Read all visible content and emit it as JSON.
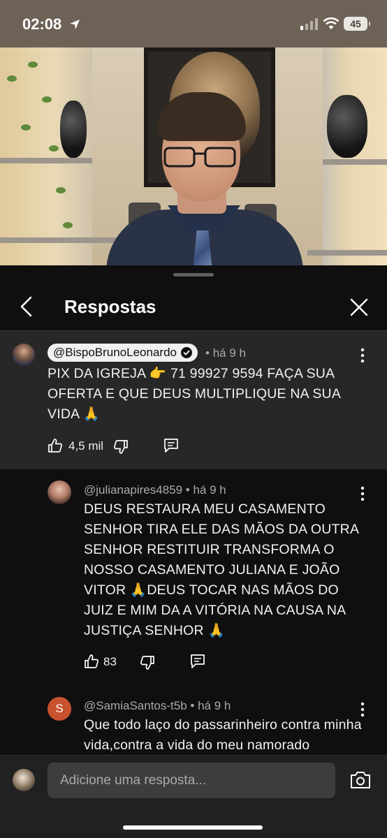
{
  "status_bar": {
    "time": "02:08",
    "battery": "45"
  },
  "header": {
    "title": "Respostas"
  },
  "pinned_comment": {
    "author": "@BispoBrunoLeonardo",
    "time": "há 9 h",
    "text": "PIX DA IGREJA 👉 71 99927 9594  FAÇA SUA OFERTA E QUE DEUS MULTIPLIQUE NA SUA VIDA 🙏",
    "likes": "4,5 mil"
  },
  "replies": [
    {
      "author": "@julianapires4859",
      "time": "há 9 h",
      "text": "DEUS RESTAURA MEU CASAMENTO SENHOR TIRA ELE DAS MÃOS DA OUTRA SENHOR RESTITUIR TRANSFORMA O NOSSO CASAMENTO JULIANA E JOÃO VITOR 🙏DEUS TOCAR NAS MÃOS DO JUIZ E MIM DA A VITÓRIA NA CAUSA NA JUSTIÇA SENHOR 🙏",
      "likes": "83"
    },
    {
      "author": "@SamiaSantos-t5b",
      "time": "há 9 h",
      "avatar_letter": "S",
      "text": "Que todo laço do passarinheiro contra minha vida,contra a vida do meu namorado"
    }
  ],
  "composer": {
    "placeholder": "Adicione uma resposta..."
  },
  "colors": {
    "background": "#0f0f0f",
    "pinned_bg": "#272727",
    "text": "#f1f1f1",
    "meta": "#aaaaaa",
    "samia_avatar": "#c8522f"
  }
}
